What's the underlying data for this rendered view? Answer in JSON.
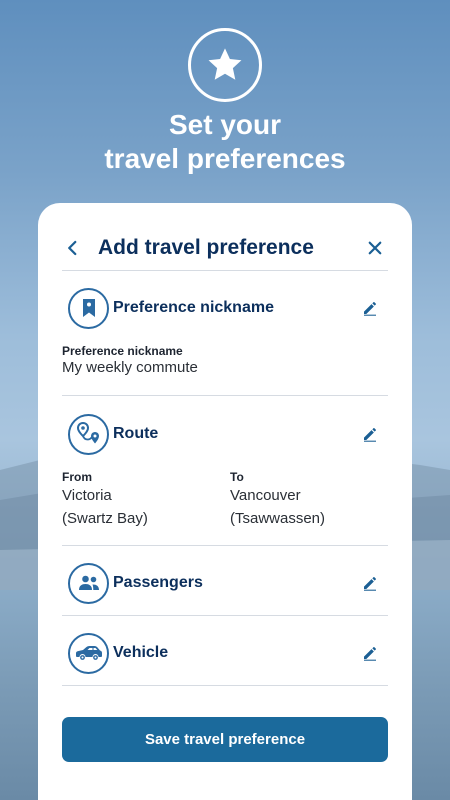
{
  "hero": {
    "title_line1": "Set your",
    "title_line2": "travel preferences"
  },
  "header": {
    "title": "Add travel preference"
  },
  "sections": {
    "nickname": {
      "label": "Preference nickname",
      "field_label": "Preference nickname",
      "field_value": "My weekly commute"
    },
    "route": {
      "label": "Route",
      "from_label": "From",
      "from_line1": "Victoria",
      "from_line2": "(Swartz Bay)",
      "to_label": "To",
      "to_line1": "Vancouver",
      "to_line2": "(Tsawwassen)"
    },
    "passengers": {
      "label": "Passengers"
    },
    "vehicle": {
      "label": "Vehicle"
    }
  },
  "save_button": {
    "label": "Save travel preference"
  },
  "icons": {
    "hero": "star-icon",
    "back": "chevron-left-icon",
    "close": "close-icon",
    "nickname": "bookmark-icon",
    "route": "route-pins-icon",
    "passengers": "people-icon",
    "vehicle": "car-icon",
    "edit": "pencil-icon"
  },
  "colors": {
    "primary_navy": "#0c2f5c",
    "accent_blue": "#2b6aa2",
    "button_blue": "#1b6a9c"
  }
}
